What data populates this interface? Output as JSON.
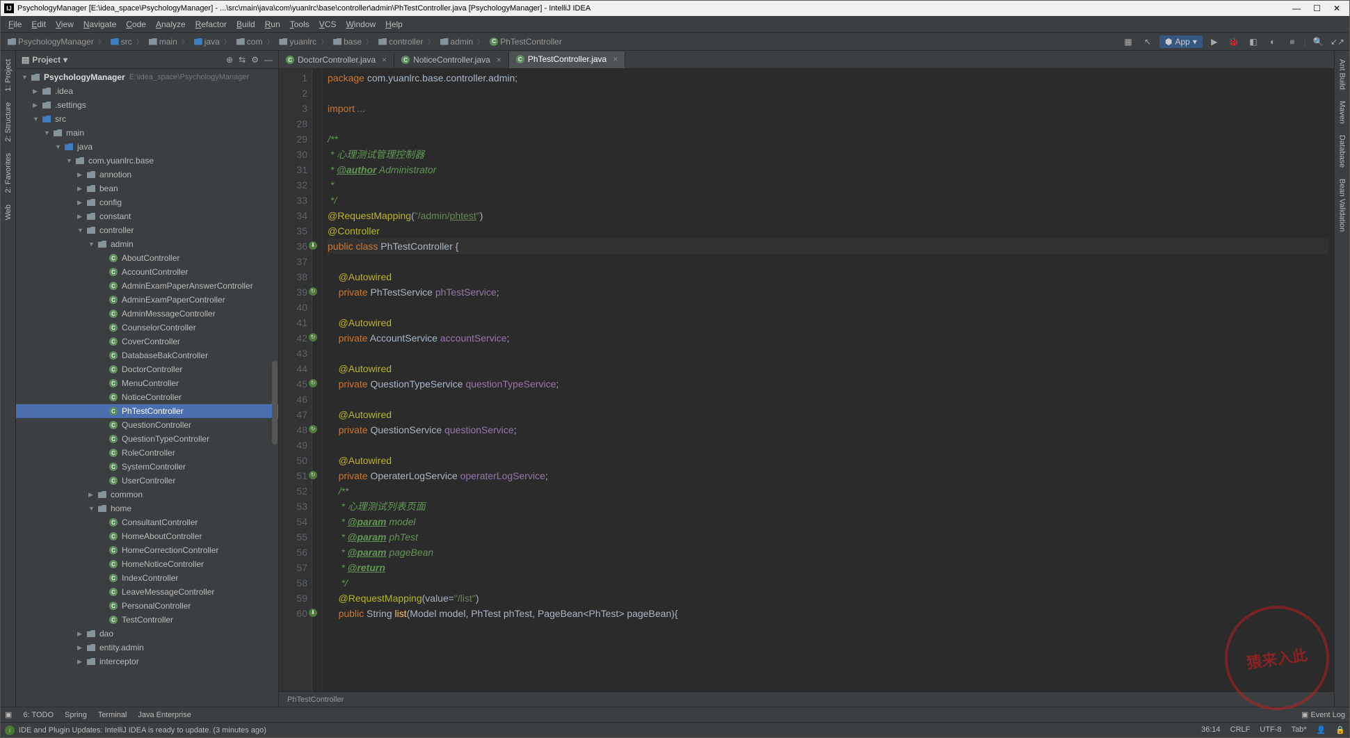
{
  "title": "PsychologyManager [E:\\idea_space\\PsychologyManager] - ...\\src\\main\\java\\com\\yuanlrc\\base\\controller\\admin\\PhTestController.java [PsychologyManager] - IntelliJ IDEA",
  "menu": [
    "File",
    "Edit",
    "View",
    "Navigate",
    "Code",
    "Analyze",
    "Refactor",
    "Build",
    "Run",
    "Tools",
    "VCS",
    "Window",
    "Help"
  ],
  "breadcrumbs": [
    "PsychologyManager",
    "src",
    "main",
    "java",
    "com",
    "yuanlrc",
    "base",
    "controller",
    "admin",
    "PhTestController"
  ],
  "run_config": "App",
  "project": {
    "title": "Project",
    "root": "PsychologyManager",
    "root_path": "E:\\idea_space\\PsychologyManager",
    "items": [
      {
        "d": 1,
        "a": "▶",
        "i": "folder",
        "t": ".idea"
      },
      {
        "d": 1,
        "a": "▶",
        "i": "folder",
        "t": ".settings"
      },
      {
        "d": 1,
        "a": "▼",
        "i": "folder-src",
        "t": "src"
      },
      {
        "d": 2,
        "a": "▼",
        "i": "folder",
        "t": "main"
      },
      {
        "d": 3,
        "a": "▼",
        "i": "folder-src",
        "t": "java"
      },
      {
        "d": 4,
        "a": "▼",
        "i": "pkg",
        "t": "com.yuanlrc.base"
      },
      {
        "d": 5,
        "a": "▶",
        "i": "pkg",
        "t": "annotion"
      },
      {
        "d": 5,
        "a": "▶",
        "i": "pkg",
        "t": "bean"
      },
      {
        "d": 5,
        "a": "▶",
        "i": "pkg",
        "t": "config"
      },
      {
        "d": 5,
        "a": "▶",
        "i": "pkg",
        "t": "constant"
      },
      {
        "d": 5,
        "a": "▼",
        "i": "pkg",
        "t": "controller"
      },
      {
        "d": 6,
        "a": "▼",
        "i": "pkg",
        "t": "admin"
      },
      {
        "d": 7,
        "a": "",
        "i": "class",
        "t": "AboutController"
      },
      {
        "d": 7,
        "a": "",
        "i": "class",
        "t": "AccountController"
      },
      {
        "d": 7,
        "a": "",
        "i": "class",
        "t": "AdminExamPaperAnswerController"
      },
      {
        "d": 7,
        "a": "",
        "i": "class",
        "t": "AdminExamPaperController"
      },
      {
        "d": 7,
        "a": "",
        "i": "class",
        "t": "AdminMessageController"
      },
      {
        "d": 7,
        "a": "",
        "i": "class",
        "t": "CounselorController"
      },
      {
        "d": 7,
        "a": "",
        "i": "class",
        "t": "CoverController"
      },
      {
        "d": 7,
        "a": "",
        "i": "class",
        "t": "DatabaseBakController"
      },
      {
        "d": 7,
        "a": "",
        "i": "class",
        "t": "DoctorController"
      },
      {
        "d": 7,
        "a": "",
        "i": "class",
        "t": "MenuController"
      },
      {
        "d": 7,
        "a": "",
        "i": "class",
        "t": "NoticeController"
      },
      {
        "d": 7,
        "a": "",
        "i": "class",
        "t": "PhTestController",
        "sel": true
      },
      {
        "d": 7,
        "a": "",
        "i": "class",
        "t": "QuestionController"
      },
      {
        "d": 7,
        "a": "",
        "i": "class",
        "t": "QuestionTypeController"
      },
      {
        "d": 7,
        "a": "",
        "i": "class",
        "t": "RoleController"
      },
      {
        "d": 7,
        "a": "",
        "i": "class",
        "t": "SystemController"
      },
      {
        "d": 7,
        "a": "",
        "i": "class",
        "t": "UserController"
      },
      {
        "d": 6,
        "a": "▶",
        "i": "pkg",
        "t": "common"
      },
      {
        "d": 6,
        "a": "▼",
        "i": "pkg",
        "t": "home"
      },
      {
        "d": 7,
        "a": "",
        "i": "class",
        "t": "ConsultantController"
      },
      {
        "d": 7,
        "a": "",
        "i": "class",
        "t": "HomeAboutController"
      },
      {
        "d": 7,
        "a": "",
        "i": "class",
        "t": "HomeCorrectionController"
      },
      {
        "d": 7,
        "a": "",
        "i": "class",
        "t": "HomeNoticeController"
      },
      {
        "d": 7,
        "a": "",
        "i": "class",
        "t": "IndexController"
      },
      {
        "d": 7,
        "a": "",
        "i": "class",
        "t": "LeaveMessageController"
      },
      {
        "d": 7,
        "a": "",
        "i": "class",
        "t": "PersonalController"
      },
      {
        "d": 7,
        "a": "",
        "i": "class",
        "t": "TestController"
      },
      {
        "d": 5,
        "a": "▶",
        "i": "pkg",
        "t": "dao"
      },
      {
        "d": 5,
        "a": "▶",
        "i": "pkg",
        "t": "entity.admin"
      },
      {
        "d": 5,
        "a": "▶",
        "i": "pkg",
        "t": "interceptor"
      }
    ]
  },
  "tabs": [
    {
      "label": "DoctorController.java",
      "active": false
    },
    {
      "label": "NoticeController.java",
      "active": false
    },
    {
      "label": "PhTestController.java",
      "active": true
    }
  ],
  "editor": {
    "lines": [
      {
        "n": 1,
        "html": "<span class='kw'>package</span> com.yuanlrc.base.controller.admin;"
      },
      {
        "n": 2,
        "html": ""
      },
      {
        "n": 3,
        "html": "<span class='kw'>import</span> <span class='com'>...</span>"
      },
      {
        "n": 28,
        "html": ""
      },
      {
        "n": 29,
        "html": "<span class='doc'>/**</span>"
      },
      {
        "n": 30,
        "html": "<span class='doc'> * 心理测试管理控制器</span>"
      },
      {
        "n": 31,
        "html": "<span class='doc'> * <span class='doctag'>@author</span> Administrator</span>"
      },
      {
        "n": 32,
        "html": "<span class='doc'> *</span>"
      },
      {
        "n": 33,
        "html": "<span class='doc'> */</span>"
      },
      {
        "n": 34,
        "html": "<span class='ann'>@RequestMapping</span>(<span class='str'>\"/admin/<u>phtest</u>\"</span>)"
      },
      {
        "n": 35,
        "html": "<span class='ann'>@Controller</span>"
      },
      {
        "n": 36,
        "cl": true,
        "gi": "g",
        "html": "<span class='kw'>public class</span> <span class='type'>PhTestController</span> {"
      },
      {
        "n": 37,
        "html": ""
      },
      {
        "n": 38,
        "html": "    <span class='ann'>@Autowired</span>"
      },
      {
        "n": 39,
        "gi": "b",
        "html": "    <span class='kw'>private</span> PhTestService <span class='field'>phTestService</span>;"
      },
      {
        "n": 40,
        "html": ""
      },
      {
        "n": 41,
        "html": "    <span class='ann'>@Autowired</span>"
      },
      {
        "n": 42,
        "gi": "b",
        "html": "    <span class='kw'>private</span> AccountService <span class='field'>accountService</span>;"
      },
      {
        "n": 43,
        "html": ""
      },
      {
        "n": 44,
        "html": "    <span class='ann'>@Autowired</span>"
      },
      {
        "n": 45,
        "gi": "b",
        "html": "    <span class='kw'>private</span> QuestionTypeService <span class='field'>questionTypeService</span>;"
      },
      {
        "n": 46,
        "html": ""
      },
      {
        "n": 47,
        "html": "    <span class='ann'>@Autowired</span>"
      },
      {
        "n": 48,
        "gi": "b",
        "html": "    <span class='kw'>private</span> QuestionService <span class='field'>questionService</span>;"
      },
      {
        "n": 49,
        "html": ""
      },
      {
        "n": 50,
        "html": "    <span class='ann'>@Autowired</span>"
      },
      {
        "n": 51,
        "gi": "b",
        "html": "    <span class='kw'>private</span> OperaterLogService <span class='field'>operaterLogService</span>;"
      },
      {
        "n": 52,
        "html": "    <span class='doc'>/**</span>"
      },
      {
        "n": 53,
        "html": "    <span class='doc'> * 心理测试列表页面</span>"
      },
      {
        "n": 54,
        "html": "    <span class='doc'> * <span class='doctag'>@param</span> model</span>"
      },
      {
        "n": 55,
        "html": "    <span class='doc'> * <span class='doctag'>@param</span> phTest</span>"
      },
      {
        "n": 56,
        "html": "    <span class='doc'> * <span class='doctag'>@param</span> pageBean</span>"
      },
      {
        "n": 57,
        "html": "    <span class='doc'> * <span class='doctag'>@return</span></span>"
      },
      {
        "n": 58,
        "html": "    <span class='doc'> */</span>"
      },
      {
        "n": 59,
        "html": "    <span class='ann'>@RequestMapping</span>(value=<span class='str'>\"/list\"</span>)"
      },
      {
        "n": 60,
        "gi": "g",
        "html": "    <span class='kw'>public</span> String <span class='name'>list</span>(Model model, PhTest phTest, PageBean&lt;PhTest&gt; pageBean){"
      }
    ],
    "breadcrumb": "PhTestController"
  },
  "left_tabs": [
    "1: Project",
    "2: Structure",
    "2: Favorites",
    "Web"
  ],
  "right_tabs": [
    "Ant Build",
    "Maven",
    "Database",
    "Bean Validation"
  ],
  "bottom_tools": {
    "left": [
      "6: TODO",
      "Spring",
      "Terminal",
      "Java Enterprise"
    ],
    "right": "Event Log"
  },
  "status": {
    "msg": "IDE and Plugin Updates: IntelliJ IDEA is ready to update. (3 minutes ago)",
    "pos": "36:14",
    "eol": "CRLF",
    "enc": "UTF-8",
    "indent": "Tab*"
  },
  "stamp": "猿来入此"
}
